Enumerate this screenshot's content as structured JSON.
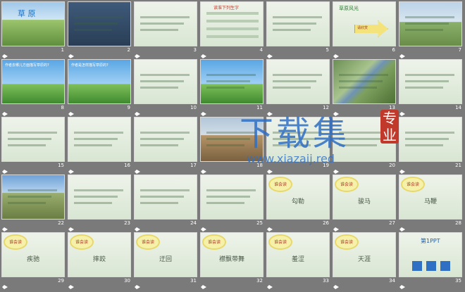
{
  "slides": [
    {
      "n": "1",
      "kind": "title",
      "title": "草 原"
    },
    {
      "n": "2",
      "kind": "portrait"
    },
    {
      "n": "3",
      "kind": "portrait-text"
    },
    {
      "n": "4",
      "kind": "table",
      "title": "读准下列生字"
    },
    {
      "n": "5",
      "kind": "list"
    },
    {
      "n": "6",
      "kind": "arrow",
      "title": "草原风光",
      "arrow_text": "请欣赏"
    },
    {
      "n": "7",
      "kind": "photo"
    },
    {
      "n": "8",
      "kind": "sky-text",
      "title": "作者去哪儿方面描写草原的?"
    },
    {
      "n": "9",
      "kind": "sky-text",
      "title": "作者是怎样描写草原的?"
    },
    {
      "n": "10",
      "kind": "field"
    },
    {
      "n": "11",
      "kind": "sky-small"
    },
    {
      "n": "12",
      "kind": "pale-photo"
    },
    {
      "n": "13",
      "kind": "river"
    },
    {
      "n": "14",
      "kind": "pale-text"
    },
    {
      "n": "15",
      "kind": "pale-text"
    },
    {
      "n": "16",
      "kind": "pale-photo"
    },
    {
      "n": "17",
      "kind": "pale-text"
    },
    {
      "n": "18",
      "kind": "crowd"
    },
    {
      "n": "19",
      "kind": "pale-text"
    },
    {
      "n": "20",
      "kind": "pale-text"
    },
    {
      "n": "21",
      "kind": "pale-text"
    },
    {
      "n": "22",
      "kind": "horse"
    },
    {
      "n": "23",
      "kind": "pale-text"
    },
    {
      "n": "24",
      "kind": "horse-photo"
    },
    {
      "n": "25",
      "kind": "pale-text"
    },
    {
      "n": "26",
      "kind": "word",
      "badge": "谁会读",
      "word": "勾勒"
    },
    {
      "n": "27",
      "kind": "word",
      "badge": "谁会读",
      "word": "骏马"
    },
    {
      "n": "28",
      "kind": "word",
      "badge": "谁会读",
      "word": "马鞭"
    },
    {
      "n": "29",
      "kind": "word",
      "badge": "谁会读",
      "word": "疾驰"
    },
    {
      "n": "30",
      "kind": "word",
      "badge": "谁会读",
      "word": "摔跤"
    },
    {
      "n": "31",
      "kind": "word",
      "badge": "谁会读",
      "word": "迂回"
    },
    {
      "n": "32",
      "kind": "word",
      "badge": "谁会读",
      "word": "襟飘带舞"
    },
    {
      "n": "33",
      "kind": "word",
      "badge": "谁会读",
      "word": "羞涩"
    },
    {
      "n": "34",
      "kind": "word",
      "badge": "谁会读",
      "word": "天涯"
    },
    {
      "n": "35",
      "kind": "brand",
      "brand": "第1PPT"
    }
  ],
  "watermark": {
    "title": "下载集",
    "badge": "专业",
    "url": "www.xiazaij.red"
  },
  "colors": {
    "accent": "#c0392b",
    "grid_bg": "#7a7a7a",
    "watermark_blue": "#2f6fc4"
  }
}
